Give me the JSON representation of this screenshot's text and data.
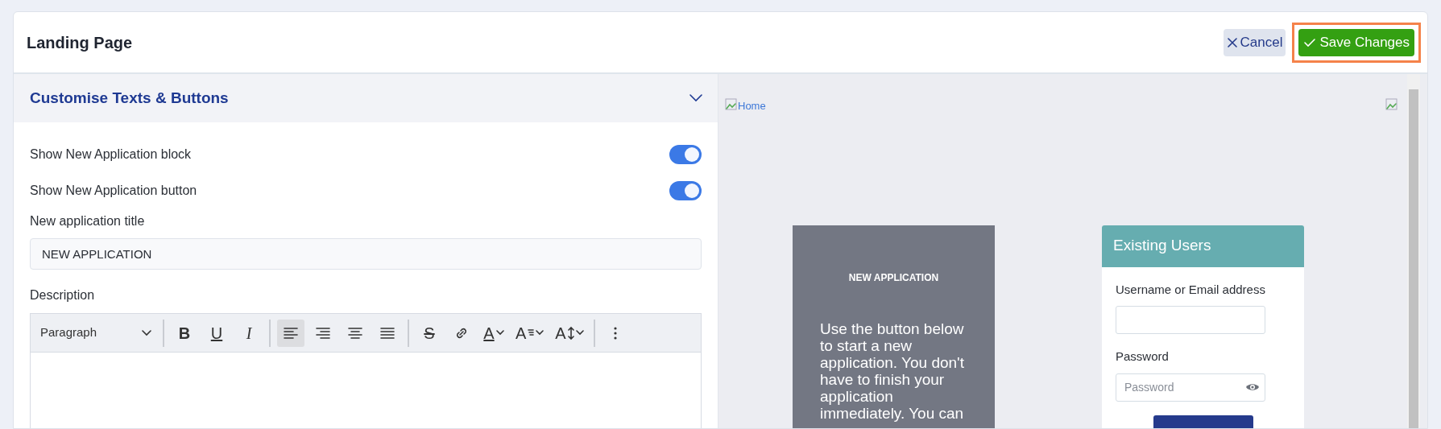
{
  "header": {
    "title": "Landing Page",
    "buttons": [
      {
        "kind": "cancel",
        "label": "Cancel",
        "highlighted": false
      },
      {
        "kind": "save",
        "label": "Save Changes",
        "highlighted": true
      }
    ]
  },
  "section": {
    "title": "Customise Texts & Buttons",
    "expanded": true,
    "toggles": [
      {
        "label": "Show New Application block",
        "checked": true
      },
      {
        "label": "Show New Application button",
        "checked": true
      }
    ],
    "title_field": {
      "label": "New application title",
      "value": "NEW APPLICATION"
    },
    "description": {
      "label": "Description",
      "toolbar": [
        {
          "kind": "select",
          "label": "Paragraph"
        },
        {
          "kind": "separator"
        },
        {
          "kind": "bold",
          "glyph": "B",
          "selected": false
        },
        {
          "kind": "underline",
          "glyph": "U",
          "selected": false
        },
        {
          "kind": "italic",
          "glyph": "I",
          "selected": false
        },
        {
          "kind": "separator"
        },
        {
          "kind": "align-left",
          "selected": true
        },
        {
          "kind": "align-right",
          "selected": false
        },
        {
          "kind": "align-center",
          "selected": false
        },
        {
          "kind": "align-justify",
          "selected": false
        },
        {
          "kind": "separator"
        },
        {
          "kind": "strike",
          "glyph": "S",
          "selected": false
        },
        {
          "kind": "link",
          "selected": false
        },
        {
          "kind": "font-color",
          "glyph": "A",
          "selected": false
        },
        {
          "kind": "font-family",
          "glyph": "A",
          "selected": false
        },
        {
          "kind": "font-size",
          "glyph": "A",
          "selected": false
        },
        {
          "kind": "separator"
        },
        {
          "kind": "more",
          "selected": false
        }
      ]
    }
  },
  "preview": {
    "logo_alt": "Home",
    "new_application": {
      "title": "NEW APPLICATION",
      "text": "Use the button below to start a new application. You don't have to finish your application immediately. You can"
    },
    "login": {
      "title": "Existing Users",
      "username_label": "Username or Email address",
      "password_label": "Password",
      "password_placeholder": "Password"
    }
  }
}
